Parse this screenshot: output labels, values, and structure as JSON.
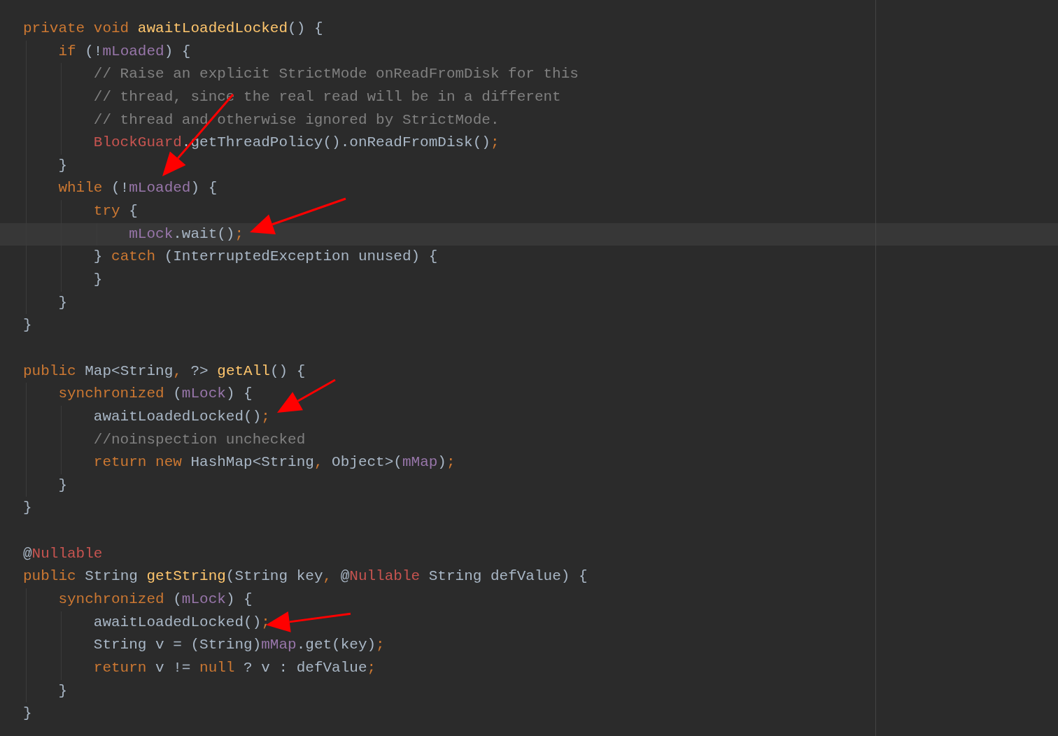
{
  "editor": {
    "lines": [
      {
        "kind": "code",
        "current": false,
        "tokens": [
          {
            "kind": "keyword",
            "text": "private void "
          },
          {
            "kind": "method",
            "text": "awaitLoadedLocked"
          },
          {
            "kind": "plain",
            "text": "() {"
          }
        ]
      },
      {
        "kind": "code",
        "current": false,
        "tokens": [
          {
            "kind": "keyword",
            "text": "    if "
          },
          {
            "kind": "plain",
            "text": "(!"
          },
          {
            "kind": "field",
            "text": "mLoaded"
          },
          {
            "kind": "plain",
            "text": ") {"
          }
        ]
      },
      {
        "kind": "code",
        "current": false,
        "tokens": [
          {
            "kind": "comment",
            "text": "        // Raise an explicit StrictMode onReadFromDisk for this"
          }
        ]
      },
      {
        "kind": "code",
        "current": false,
        "tokens": [
          {
            "kind": "comment",
            "text": "        // thread, since the real read will be in a different"
          }
        ]
      },
      {
        "kind": "code",
        "current": false,
        "tokens": [
          {
            "kind": "comment",
            "text": "        // thread and otherwise ignored by StrictMode."
          }
        ]
      },
      {
        "kind": "code",
        "current": false,
        "tokens": [
          {
            "kind": "error",
            "text": "        BlockGuard"
          },
          {
            "kind": "plain",
            "text": ".getThreadPolicy().onReadFromDisk()"
          },
          {
            "kind": "keyword",
            "text": ";"
          }
        ]
      },
      {
        "kind": "code",
        "current": false,
        "tokens": [
          {
            "kind": "plain",
            "text": "    }"
          }
        ]
      },
      {
        "kind": "code",
        "current": false,
        "tokens": [
          {
            "kind": "keyword",
            "text": "    while "
          },
          {
            "kind": "plain",
            "text": "(!"
          },
          {
            "kind": "field",
            "text": "mLoaded"
          },
          {
            "kind": "plain",
            "text": ") {"
          }
        ]
      },
      {
        "kind": "code",
        "current": false,
        "tokens": [
          {
            "kind": "keyword",
            "text": "        try "
          },
          {
            "kind": "plain",
            "text": "{"
          }
        ]
      },
      {
        "kind": "code",
        "current": true,
        "tokens": [
          {
            "kind": "field",
            "text": "            mLock"
          },
          {
            "kind": "plain",
            "text": ".wait()"
          },
          {
            "kind": "keyword",
            "text": ";"
          }
        ]
      },
      {
        "kind": "code",
        "current": false,
        "tokens": [
          {
            "kind": "plain",
            "text": "        } "
          },
          {
            "kind": "keyword",
            "text": "catch "
          },
          {
            "kind": "plain",
            "text": "(InterruptedException unused) {"
          }
        ]
      },
      {
        "kind": "code",
        "current": false,
        "tokens": [
          {
            "kind": "plain",
            "text": "        }"
          }
        ]
      },
      {
        "kind": "code",
        "current": false,
        "tokens": [
          {
            "kind": "plain",
            "text": "    }"
          }
        ]
      },
      {
        "kind": "code",
        "current": false,
        "tokens": [
          {
            "kind": "plain",
            "text": "}"
          }
        ]
      },
      {
        "kind": "blank"
      },
      {
        "kind": "code",
        "current": false,
        "tokens": [
          {
            "kind": "keyword",
            "text": "public "
          },
          {
            "kind": "plain",
            "text": "Map<String"
          },
          {
            "kind": "keyword",
            "text": ", "
          },
          {
            "kind": "plain",
            "text": "?> "
          },
          {
            "kind": "method",
            "text": "getAll"
          },
          {
            "kind": "plain",
            "text": "() {"
          }
        ]
      },
      {
        "kind": "code",
        "current": false,
        "tokens": [
          {
            "kind": "keyword",
            "text": "    synchronized "
          },
          {
            "kind": "plain",
            "text": "("
          },
          {
            "kind": "field",
            "text": "mLock"
          },
          {
            "kind": "plain",
            "text": ") {"
          }
        ]
      },
      {
        "kind": "code",
        "current": false,
        "tokens": [
          {
            "kind": "plain",
            "text": "        awaitLoadedLocked()"
          },
          {
            "kind": "keyword",
            "text": ";"
          }
        ]
      },
      {
        "kind": "code",
        "current": false,
        "tokens": [
          {
            "kind": "comment",
            "text": "        //noinspection unchecked"
          }
        ]
      },
      {
        "kind": "code",
        "current": false,
        "tokens": [
          {
            "kind": "keyword",
            "text": "        return new "
          },
          {
            "kind": "plain",
            "text": "HashMap<String"
          },
          {
            "kind": "keyword",
            "text": ", "
          },
          {
            "kind": "plain",
            "text": "Object>("
          },
          {
            "kind": "field",
            "text": "mMap"
          },
          {
            "kind": "plain",
            "text": ")"
          },
          {
            "kind": "keyword",
            "text": ";"
          }
        ]
      },
      {
        "kind": "code",
        "current": false,
        "tokens": [
          {
            "kind": "plain",
            "text": "    }"
          }
        ]
      },
      {
        "kind": "code",
        "current": false,
        "tokens": [
          {
            "kind": "plain",
            "text": "}"
          }
        ]
      },
      {
        "kind": "blank"
      },
      {
        "kind": "code",
        "current": false,
        "tokens": [
          {
            "kind": "plain",
            "text": "@"
          },
          {
            "kind": "error",
            "text": "Nullable"
          }
        ]
      },
      {
        "kind": "code",
        "current": false,
        "tokens": [
          {
            "kind": "keyword",
            "text": "public "
          },
          {
            "kind": "plain",
            "text": "String "
          },
          {
            "kind": "method",
            "text": "getString"
          },
          {
            "kind": "plain",
            "text": "(String key"
          },
          {
            "kind": "keyword",
            "text": ", "
          },
          {
            "kind": "plain",
            "text": "@"
          },
          {
            "kind": "error",
            "text": "Nullable "
          },
          {
            "kind": "plain",
            "text": "String defValue) {"
          }
        ]
      },
      {
        "kind": "code",
        "current": false,
        "tokens": [
          {
            "kind": "keyword",
            "text": "    synchronized "
          },
          {
            "kind": "plain",
            "text": "("
          },
          {
            "kind": "field",
            "text": "mLock"
          },
          {
            "kind": "plain",
            "text": ") {"
          }
        ]
      },
      {
        "kind": "code",
        "current": false,
        "tokens": [
          {
            "kind": "plain",
            "text": "        awaitLoadedLocked()"
          },
          {
            "kind": "keyword",
            "text": ";"
          }
        ]
      },
      {
        "kind": "code",
        "current": false,
        "tokens": [
          {
            "kind": "plain",
            "text": "        String v = (String)"
          },
          {
            "kind": "field",
            "text": "mMap"
          },
          {
            "kind": "plain",
            "text": ".get(key)"
          },
          {
            "kind": "keyword",
            "text": ";"
          }
        ]
      },
      {
        "kind": "code",
        "current": false,
        "tokens": [
          {
            "kind": "keyword",
            "text": "        return "
          },
          {
            "kind": "plain",
            "text": "v != "
          },
          {
            "kind": "keyword",
            "text": "null "
          },
          {
            "kind": "plain",
            "text": "? v : defValue"
          },
          {
            "kind": "keyword",
            "text": ";"
          }
        ]
      },
      {
        "kind": "code",
        "current": false,
        "tokens": [
          {
            "kind": "plain",
            "text": "    }"
          }
        ]
      },
      {
        "kind": "code",
        "current": false,
        "tokens": [
          {
            "kind": "plain",
            "text": "}"
          }
        ]
      }
    ]
  }
}
